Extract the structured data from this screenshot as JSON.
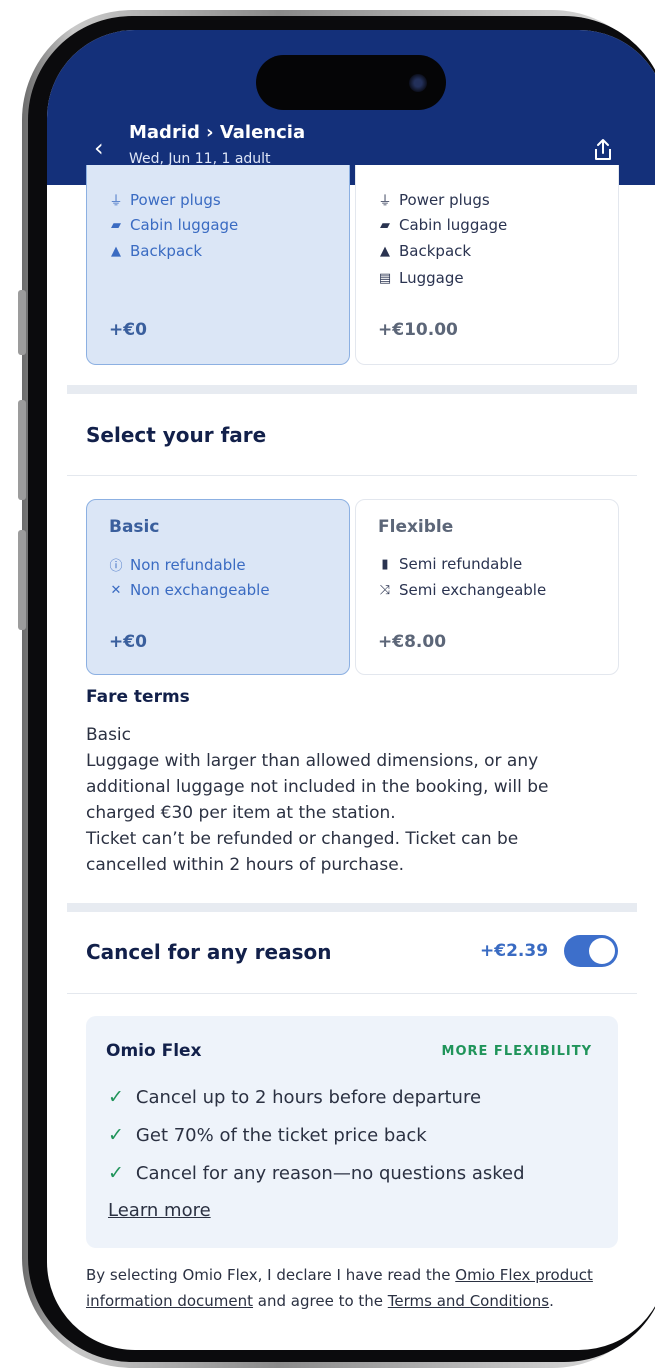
{
  "header": {
    "route": "Madrid › Valencia",
    "subtitle": "Wed, Jun 11, 1 adult"
  },
  "amenities": {
    "left": {
      "items": [
        "Power plugs",
        "Cabin luggage",
        "Backpack"
      ],
      "price": "+€0"
    },
    "right": {
      "items": [
        "Power plugs",
        "Cabin luggage",
        "Backpack",
        "Luggage"
      ],
      "price": "+€10.00"
    }
  },
  "fare_section": {
    "title": "Select your fare",
    "basic": {
      "name": "Basic",
      "features": [
        "Non refundable",
        "Non exchangeable"
      ],
      "price": "+€0"
    },
    "flexible": {
      "name": "Flexible",
      "features": [
        "Semi refundable",
        "Semi exchangeable"
      ],
      "price": "+€8.00"
    }
  },
  "fare_terms": {
    "heading": "Fare terms",
    "lines": [
      "Basic",
      "Luggage with larger than allowed dimensions, or any",
      "additional luggage not included in the booking, will be",
      "charged €30 per item at the station.",
      "Ticket can’t be refunded or changed. Ticket can be",
      "cancelled within 2 hours of purchase."
    ]
  },
  "cancel": {
    "title": "Cancel for any reason",
    "price": "+€2.39",
    "toggle_on": true
  },
  "omio_flex": {
    "title": "Omio Flex",
    "badge": "MORE FLEXIBILITY",
    "bullets": [
      "Cancel up to 2 hours before departure",
      "Get 70% of the ticket price back",
      "Cancel for any reason—no questions asked"
    ],
    "learn_more": "Learn more"
  },
  "legal": {
    "prefix": "By selecting Omio Flex, I declare I have read the ",
    "link1": "Omio Flex product information document",
    "middle": " and agree to the ",
    "link2": "Terms and Conditions",
    "suffix": "."
  },
  "colors": {
    "header_bg": "#14307a",
    "selected_card_bg": "#dbe6f6",
    "accent_blue": "#3d6fcb",
    "badge_green": "#20945a"
  }
}
